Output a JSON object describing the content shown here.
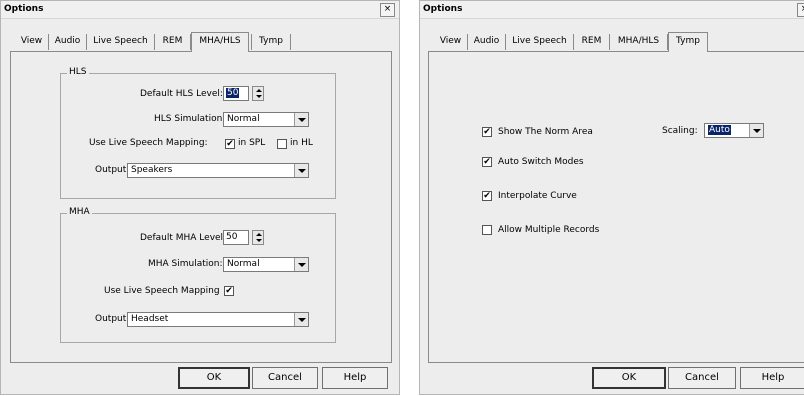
{
  "left": {
    "title": "Options",
    "close": "×",
    "tabs": [
      "View",
      "Audio",
      "Live Speech",
      "REM",
      "MHA/HLS",
      "Tymp"
    ],
    "hls": {
      "legend": "HLS",
      "level_label": "Default HLS Level:",
      "level_value": "50",
      "sim_label": "HLS Simulation:",
      "sim_value": "Normal",
      "map_label": "Use Live Speech Mapping:",
      "in_spl": "in SPL",
      "in_hl": "in HL",
      "output_label": "Output:",
      "output_value": "Speakers"
    },
    "mha": {
      "legend": "MHA",
      "level_label": "Default MHA Level:",
      "level_value": "50",
      "sim_label": "MHA Simulation:",
      "sim_value": "Normal",
      "map_label": "Use Live Speech Mapping",
      "output_label": "Output:",
      "output_value": "Headset"
    },
    "buttons": {
      "ok": "OK",
      "cancel": "Cancel",
      "help": "Help"
    }
  },
  "right": {
    "title": "Options",
    "tabs": [
      "View",
      "Audio",
      "Live Speech",
      "REM",
      "MHA/HLS",
      "Tymp"
    ],
    "options": {
      "show_norm": "Show The Norm Area",
      "auto_switch": "Auto Switch Modes",
      "interpolate": "Interpolate Curve",
      "allow_multiple": "Allow Multiple Records"
    },
    "scaling_label": "Scaling:",
    "scaling_value": "Auto",
    "buttons": {
      "ok": "OK",
      "cancel": "Cancel",
      "help": "Help"
    }
  },
  "checkmark": "✔"
}
